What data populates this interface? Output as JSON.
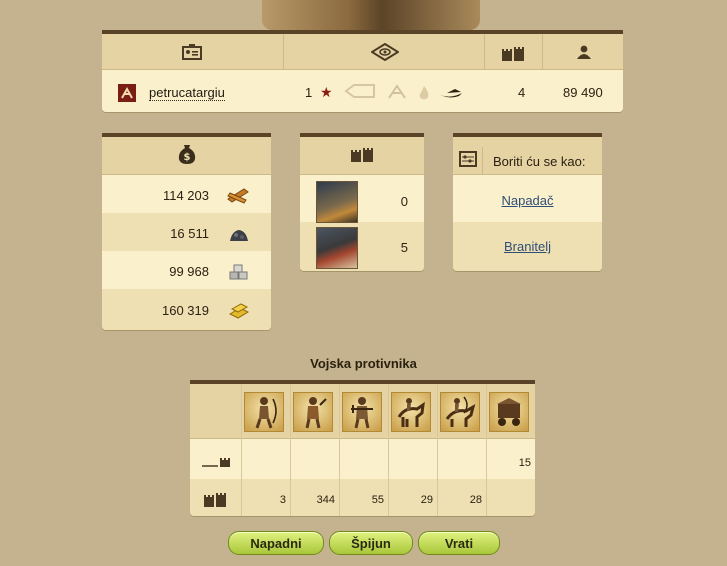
{
  "player": {
    "name": "petrucatargiu",
    "rank": "1",
    "castles": "4",
    "points": "89 490"
  },
  "resources": {
    "wood": "114 203",
    "ore": "16 511",
    "stone": "99 968",
    "gold": "160 319"
  },
  "castles": {
    "row1_count": "0",
    "row2_count": "5"
  },
  "fight": {
    "title": "Boriti ću se kao:",
    "attacker": "Napadač",
    "defender": "Branitelj"
  },
  "army": {
    "title": "Vojska protivnika",
    "row1": [
      "",
      "",
      "",
      "",
      "",
      "15"
    ],
    "row2": [
      "3",
      "344",
      "55",
      "29",
      "28",
      ""
    ]
  },
  "buttons": {
    "attack": "Napadni",
    "spy": "Špijun",
    "back": "Vrati"
  },
  "icons": {
    "header_id": "id-card-icon",
    "header_map": "map-eye-icon",
    "header_castle": "castle-icon",
    "header_user": "user-icon"
  }
}
